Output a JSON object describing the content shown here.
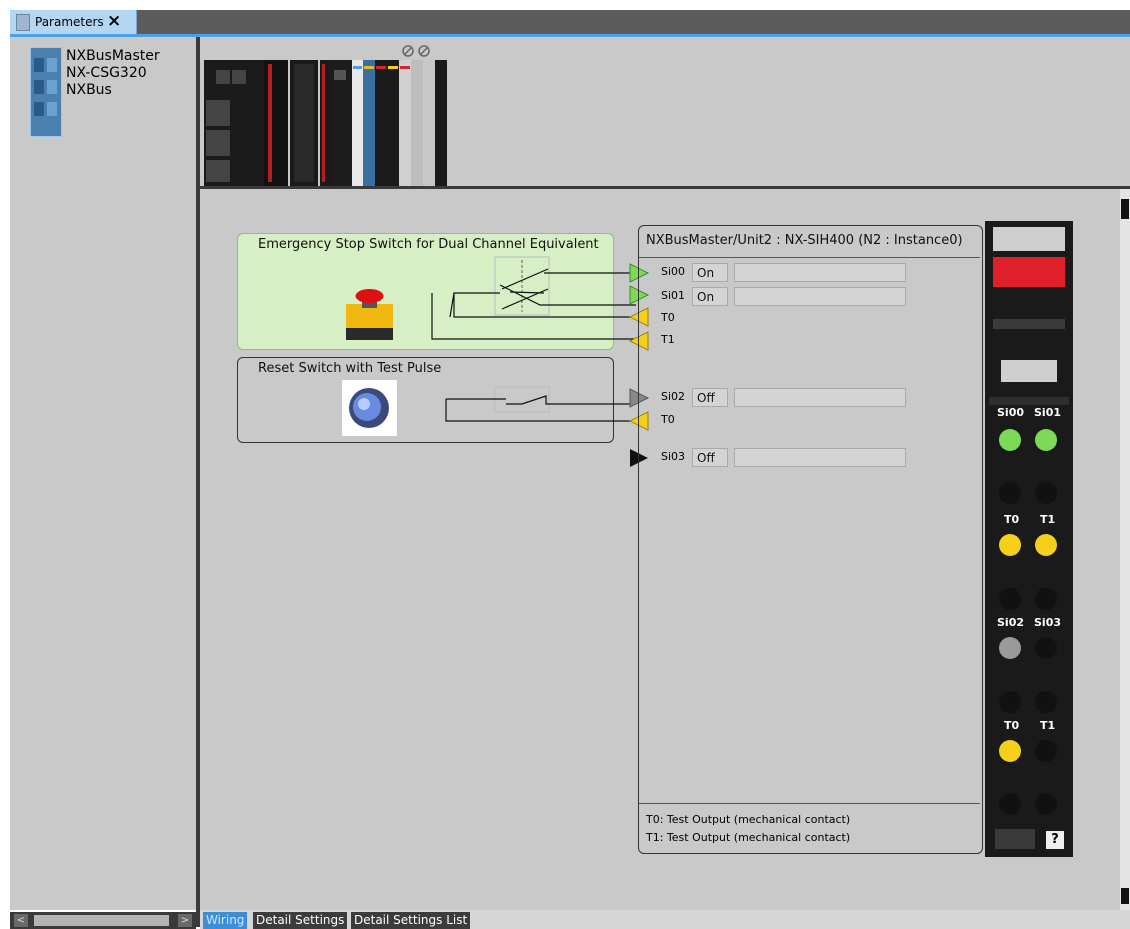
{
  "tab": {
    "title": "Parameters",
    "close": "×"
  },
  "left_panel": {
    "device": {
      "name": "NXBusMaster",
      "model": "NX-CSG320",
      "bus": "NXBus"
    }
  },
  "wiring": {
    "device1": {
      "title": "Emergency Stop Switch for Dual Channel Equivalent"
    },
    "device2": {
      "title": "Reset Switch with Test Pulse"
    },
    "unit": {
      "title": "NXBusMaster/Unit2 : NX-SIH400 (N2 : Instance0)",
      "signals": [
        {
          "name": "Si00",
          "status": "On"
        },
        {
          "name": "Si01",
          "status": "On"
        },
        {
          "name": "T0"
        },
        {
          "name": "T1"
        },
        {
          "name": "Si02",
          "status": "Off"
        },
        {
          "name": "T0"
        },
        {
          "name": "Si03",
          "status": "Off"
        }
      ],
      "notes": [
        "T0: Test Output (mechanical contact)",
        "T1: Test Output (mechanical contact)"
      ]
    },
    "module": {
      "labels": {
        "si00": "Si00",
        "si01": "Si01",
        "t0a": "T0",
        "t1a": "T1",
        "si02": "Si02",
        "si03": "Si03",
        "t0b": "T0",
        "t1b": "T1"
      },
      "help": "?"
    }
  },
  "bottom_tabs": [
    "Wiring",
    "Detail Settings",
    "Detail Settings List"
  ],
  "colors": {
    "accent": "#4da0e6",
    "led_green": "#7ed957",
    "led_yellow": "#f5d018",
    "device_highlight": "#d6efc4",
    "status_red": "#e0202a"
  }
}
